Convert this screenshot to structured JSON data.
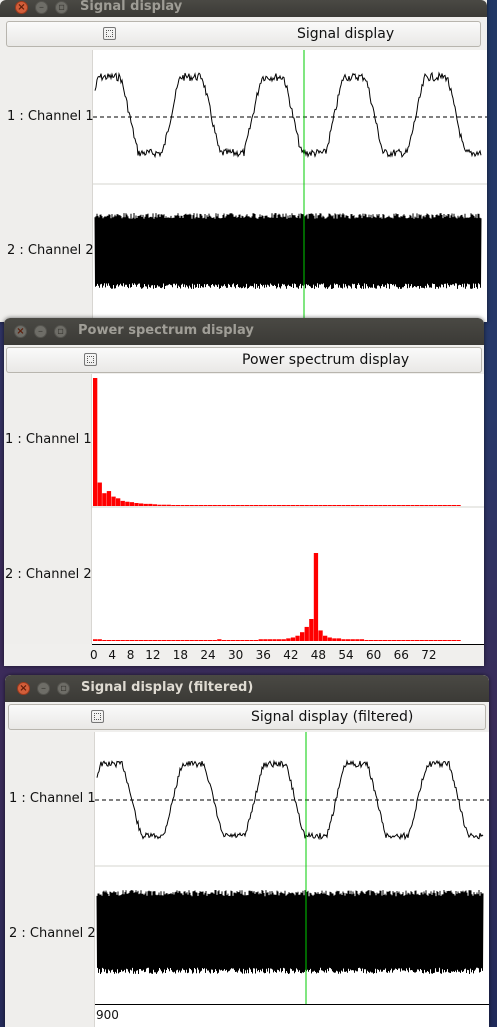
{
  "desktop": {
    "background": "#27386a"
  },
  "windows": {
    "signal": {
      "title": "Signal display",
      "tool_button_label": "Signal display",
      "channels": [
        {
          "label": "1 : Channel 1"
        },
        {
          "label": "2 : Channel 2"
        }
      ],
      "cursor_color": "#00cc00",
      "trace_color": "#000000"
    },
    "spectrum": {
      "title": "Power spectrum display",
      "tool_button_label": "Power spectrum display",
      "channels": [
        {
          "label": "1 : Channel 1"
        },
        {
          "label": "2 : Channel 2"
        }
      ],
      "bar_color": "#ff0000",
      "x_ticks": [
        "0",
        "4",
        "8",
        "12",
        "18",
        "24",
        "30",
        "36",
        "42",
        "48",
        "54",
        "60",
        "66",
        "72"
      ]
    },
    "filtered": {
      "title": "Signal display (filtered)",
      "tool_button_label": "Signal display (filtered)",
      "channels": [
        {
          "label": "1 : Channel 1"
        },
        {
          "label": "2 : Channel 2"
        }
      ],
      "cursor_color": "#00cc00",
      "time_label": "900"
    }
  },
  "chart_data": [
    {
      "type": "bar",
      "series": [
        {
          "values": [
            3.0,
            0.55,
            0.3,
            0.35,
            0.22,
            0.18,
            0.12,
            0.1,
            0.09,
            0.07,
            0.06,
            0.05,
            0.05,
            0.04,
            0.03,
            0.03,
            0.03,
            0.02,
            0.02,
            0.02,
            0.02,
            0.02,
            0.01,
            0.01,
            0.01,
            0.01,
            0.01,
            0.01,
            0.01,
            0.01,
            0.01,
            0.01,
            0.01,
            0.01,
            0.01,
            0.01,
            0.01,
            0.01,
            0.01,
            0.01,
            0.01,
            0.01,
            0.01,
            0.01,
            0.01,
            0.01,
            0.01,
            0.01,
            0.01,
            0.01,
            0.01,
            0.01,
            0.01,
            0.01,
            0.01,
            0.01,
            0.01,
            0.01,
            0.01,
            0.01,
            0.01,
            0.01,
            0.01,
            0.01,
            0.01,
            0.01,
            0.01,
            0.01,
            0.01,
            0.01,
            0.01,
            0.01,
            0.01,
            0.01,
            0.01,
            0.01,
            0.01,
            0.01,
            0.01,
            0.01
          ]
        }
      ],
      "x_start": 0,
      "x_step": 1,
      "x_tick_labels": [
        "0",
        "4",
        "8",
        "12",
        "18",
        "24",
        "30",
        "36",
        "42",
        "48",
        "54",
        "60",
        "66",
        "72"
      ]
    },
    {
      "type": "bar",
      "series": [
        {
          "values": [
            0.02,
            0.02,
            0.01,
            0.01,
            0.01,
            0.01,
            0.01,
            0.01,
            0.01,
            0.01,
            0.01,
            0.01,
            0.01,
            0.01,
            0.01,
            0.01,
            0.01,
            0.01,
            0.01,
            0.01,
            0.01,
            0.01,
            0.01,
            0.01,
            0.01,
            0.01,
            0.01,
            0.02,
            0.01,
            0.01,
            0.01,
            0.01,
            0.01,
            0.01,
            0.01,
            0.01,
            0.02,
            0.02,
            0.02,
            0.02,
            0.02,
            0.02,
            0.03,
            0.04,
            0.06,
            0.1,
            0.16,
            0.25,
            1.0,
            0.12,
            0.06,
            0.04,
            0.03,
            0.03,
            0.02,
            0.02,
            0.02,
            0.02,
            0.02,
            0.01,
            0.01,
            0.01,
            0.01,
            0.01,
            0.01,
            0.01,
            0.01,
            0.01,
            0.01,
            0.01,
            0.01,
            0.01,
            0.01,
            0.01,
            0.01,
            0.01,
            0.01,
            0.01,
            0.01,
            0.01
          ]
        }
      ],
      "x_start": 0,
      "x_step": 1
    }
  ]
}
